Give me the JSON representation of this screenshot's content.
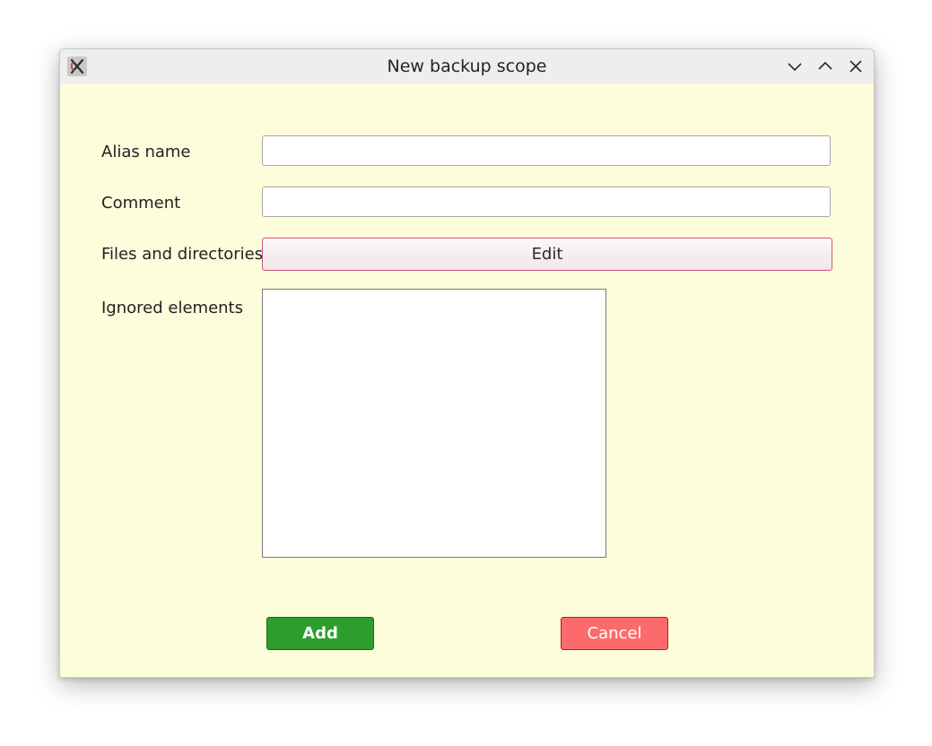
{
  "window": {
    "title": "New backup scope"
  },
  "titlebar": {
    "icons": [
      "app-icon",
      "minimize-icon",
      "maximize-icon",
      "close-icon"
    ]
  },
  "form": {
    "alias": {
      "label": "Alias name",
      "value": "",
      "placeholder": ""
    },
    "comment": {
      "label": "Comment",
      "value": "",
      "placeholder": ""
    },
    "files": {
      "label": "Files and directories",
      "button_label": "Edit"
    },
    "ignored": {
      "label": "Ignored elements",
      "items": []
    }
  },
  "actions": {
    "add_label": "Add",
    "cancel_label": "Cancel"
  },
  "colors": {
    "window_background": "#fdfddc",
    "titlebar_background": "#eeeeee",
    "add_button": "#2d9e2d",
    "cancel_button": "#fb6b6b",
    "edit_button_border": "#c8587c"
  }
}
